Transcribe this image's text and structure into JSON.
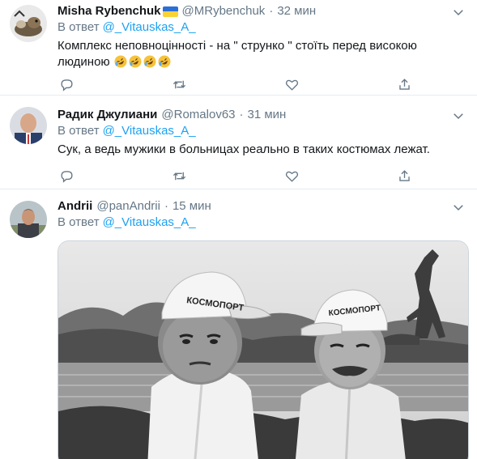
{
  "tweets": [
    {
      "name": "Misha Rybenchuk",
      "has_flag": true,
      "handle": "@MRybenchuk",
      "dot": "·",
      "time": "32 мин",
      "reply_prefix": "В ответ",
      "reply_handle": "@_Vitauskas_A_",
      "text": "Комплекс неповноцінності - на \" струнко \" стоїть перед високою людиною",
      "emoji": [
        "rolling-laughing",
        "rolling-laughing",
        "rolling-laughing",
        "rolling-laughing"
      ]
    },
    {
      "name": "Радик Джулиани",
      "handle": "@Romalov63",
      "dot": "·",
      "time": "31 мин",
      "reply_prefix": "В ответ",
      "reply_handle": "@_Vitauskas_A_",
      "text": "Сук, а ведь мужики в больницах реально в таких костюмах лежат."
    },
    {
      "name": "Andrii",
      "handle": "@panAndrii",
      "dot": "·",
      "time": "15 мин",
      "reply_prefix": "В ответ",
      "reply_handle": "@_Vitauskas_A_",
      "media": {
        "cap_left": "КОСМОПОРТ",
        "cap_right": "КОСМОПОРТ"
      }
    }
  ],
  "icons": [
    "reply-icon",
    "retweet-icon",
    "like-icon",
    "share-icon",
    "chevron-down-icon"
  ],
  "colors": {
    "link": "#1da1f2",
    "muted": "#657786",
    "text": "#14171a",
    "divider": "#e6ecf0"
  }
}
